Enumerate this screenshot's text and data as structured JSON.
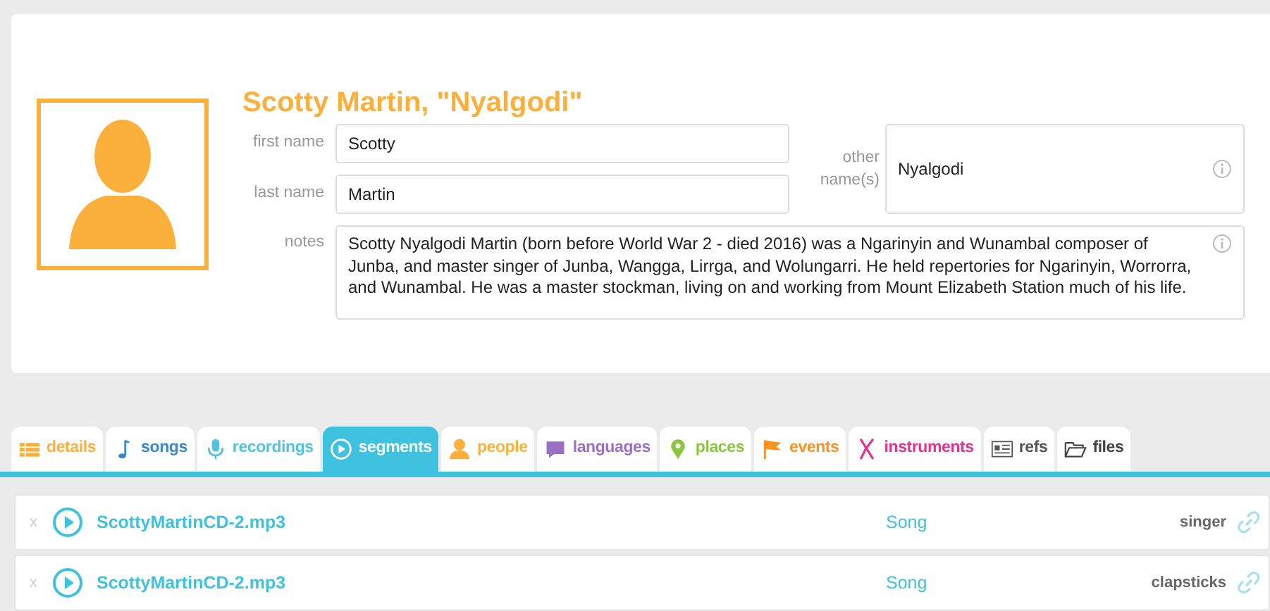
{
  "person": {
    "title": "Scotty Martin, \"Nyalgodi\"",
    "fields": {
      "first_name": {
        "label": "first name",
        "value": "Scotty"
      },
      "last_name": {
        "label": "last name",
        "value": "Martin"
      },
      "other_names": {
        "label": "other name(s)",
        "value": "Nyalgodi"
      },
      "notes": {
        "label": "notes",
        "value": "Scotty Nyalgodi Martin (born before World War 2 - died 2016) was a Ngarinyin and Wunambal composer of Junba, and master singer of Junba, Wangga, Lirrga, and Wolungarri. He held repertories for Ngarinyin, Worrorra, and Wunambal. He was a master stockman, living on and working from Mount Elizabeth Station much of his life."
      }
    }
  },
  "tabs": [
    {
      "label": "details",
      "color": "#fbb03b",
      "selected": false
    },
    {
      "label": "songs",
      "color": "#3a87c9",
      "selected": false
    },
    {
      "label": "recordings",
      "color": "#4fc3e0",
      "selected": false
    },
    {
      "label": "segments",
      "color": "#3fc1e0",
      "selected": true
    },
    {
      "label": "people",
      "color": "#fbb03b",
      "selected": false
    },
    {
      "label": "languages",
      "color": "#9b6fc4",
      "selected": false
    },
    {
      "label": "places",
      "color": "#8cc63f",
      "selected": false
    },
    {
      "label": "events",
      "color": "#f7931e",
      "selected": false
    },
    {
      "label": "instruments",
      "color": "#e0358f",
      "selected": false
    },
    {
      "label": "refs",
      "color": "#555555",
      "selected": false
    },
    {
      "label": "files",
      "color": "#444444",
      "selected": false
    }
  ],
  "segments": [
    {
      "remove": "x",
      "file": "ScottyMartinCD-2.mp3",
      "type": "Song",
      "role": "singer"
    },
    {
      "remove": "x",
      "file": "ScottyMartinCD-2.mp3",
      "type": "Song",
      "role": "clapsticks"
    }
  ]
}
